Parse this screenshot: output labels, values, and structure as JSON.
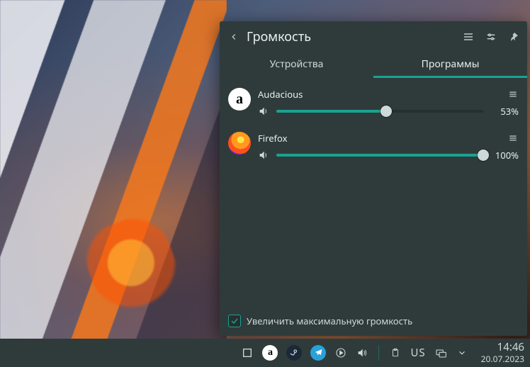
{
  "panel": {
    "title": "Громкость",
    "tabs": {
      "devices": "Устройства",
      "apps": "Программы"
    },
    "active_tab": "apps",
    "apps": [
      {
        "name": "Audacious",
        "volume_percent": 53,
        "volume_label": "53%",
        "icon": "audacious"
      },
      {
        "name": "Firefox",
        "volume_percent": 100,
        "volume_label": "100%",
        "icon": "firefox"
      }
    ],
    "boost_checkbox": {
      "checked": true,
      "label": "Увеличить максимальную громкость"
    }
  },
  "taskbar": {
    "keyboard_layout": "US",
    "time": "14:46",
    "date": "20.07.2023"
  }
}
